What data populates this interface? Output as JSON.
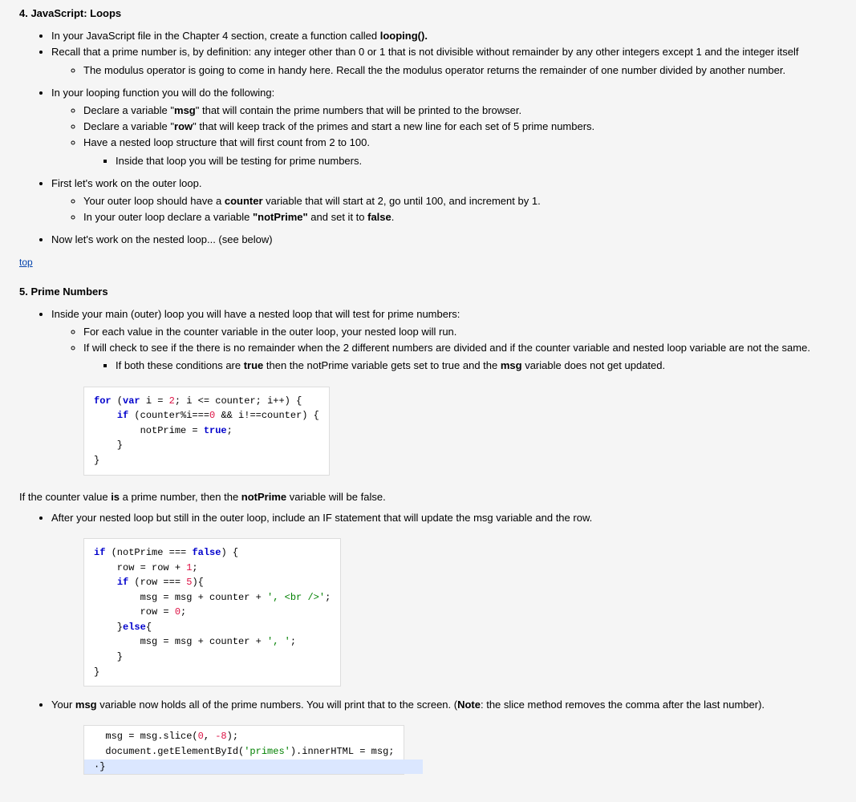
{
  "section4": {
    "heading": "4. JavaScript: Loops",
    "bullets": {
      "b1a": "In your JavaScript file in the Chapter 4 section, create a function called ",
      "b1b": "looping().",
      "b2": "Recall that a prime number is, by definition: any integer other than 0 or 1 that is not divisible without remainder by any other integers except 1 and the integer itself",
      "b2_1": "The modulus operator is going to come in handy here. Recall the the modulus operator returns the remainder of one number divided by another number.",
      "b3": "In your looping function you will do the following:",
      "b3_1a": "Declare a variable \"",
      "b3_1b": "msg",
      "b3_1c": "\" that will contain the prime numbers that will be printed to the browser.",
      "b3_2a": "Declare a variable \"",
      "b3_2b": "row",
      "b3_2c": "\" that will keep track of the primes and start a new line for each set of 5 prime numbers.",
      "b3_3": "Have a nested loop structure that will first count from 2 to 100.",
      "b3_3_1": "Inside that loop you will be testing for prime numbers.",
      "b4": "First let's work on the outer loop.",
      "b4_1a": "Your outer loop should have a ",
      "b4_1b": "counter",
      "b4_1c": " variable that will start at 2, go until 100, and increment by 1.",
      "b4_2a": "In your outer loop declare a variable ",
      "b4_2b": "\"notPrime\"",
      "b4_2c": " and set it to ",
      "b4_2d": "false",
      "b4_2e": ".",
      "b5": "Now let's work on the nested loop... (see below)"
    }
  },
  "topLink": "top",
  "section5": {
    "heading": "5. Prime Numbers",
    "b1": "Inside your main (outer) loop you will have a nested loop that will test for prime numbers:",
    "b1_1": "For each value in the counter variable in the outer loop, your nested loop will run.",
    "b1_2": "If will check to see if the there is no remainder when the 2 different numbers are divided and if the counter variable and nested loop variable are not the same.",
    "b1_2_1a": "If both these conditions are ",
    "b1_2_1b": "true",
    "b1_2_1c": " then the notPrime variable gets set to true and the ",
    "b1_2_1d": "msg",
    "b1_2_1e": " variable does not get updated.",
    "code1": {
      "l1a": "for",
      "l1b": " (",
      "l1c": "var",
      "l1d": " i = ",
      "l1e": "2",
      "l1f": "; i <= counter; i++) {",
      "l2a": "    ",
      "l2b": "if",
      "l2c": " (counter%i===",
      "l2d": "0",
      "l2e": " && i!==counter) {",
      "l3a": "        notPrime = ",
      "l3b": "true",
      "l3c": ";",
      "l4": "    }",
      "l5": "}"
    },
    "mid_a": "If the counter value ",
    "mid_b": "is",
    "mid_c": " a prime number, then the ",
    "mid_d": "notPrime",
    "mid_e": " variable will be false.",
    "b2": "After your nested loop but still in the outer loop, include an IF statement that will update the msg variable and the row.",
    "code2": {
      "l1a": "if",
      "l1b": " (notPrime === ",
      "l1c": "false",
      "l1d": ") {",
      "l2a": "    row = row + ",
      "l2b": "1",
      "l2c": ";",
      "l3a": "    ",
      "l3b": "if",
      "l3c": " (row === ",
      "l3d": "5",
      "l3e": "){",
      "l4a": "        msg = msg + counter + ",
      "l4b": "', <br />'",
      "l4c": ";",
      "l5a": "        row = ",
      "l5b": "0",
      "l5c": ";",
      "l6a": "    }",
      "l6b": "else",
      "l6c": "{",
      "l7a": "        msg = msg + counter + ",
      "l7b": "', '",
      "l7c": ";",
      "l8": "    }",
      "l9": "}"
    },
    "b3a": "Your ",
    "b3b": "msg",
    "b3c": " variable now holds all of the prime numbers. You will print that to the screen. (",
    "b3d": "Note",
    "b3e": ": the slice method removes the comma after the last number).",
    "code3": {
      "l1a": "  msg = msg.slice(",
      "l1b": "0",
      "l1c": ", ",
      "l1d": "-8",
      "l1e": ");",
      "l2a": "  document.getElementById(",
      "l2b": "'primes'",
      "l2c": ").innerHTML = msg;",
      "l3": "·}"
    }
  }
}
